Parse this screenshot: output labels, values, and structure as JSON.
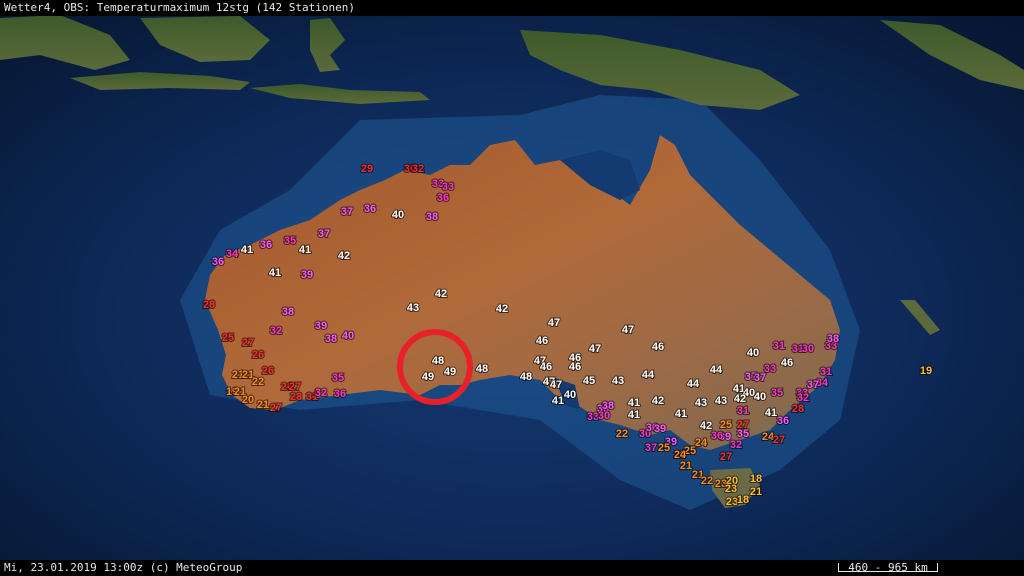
{
  "header": {
    "title": "Wetter4, OBS: Temperaturmaximum 12stg (142 Stationen)"
  },
  "footer": {
    "timestamp": "Mi, 23.01.2019 13:00z (c) MeteoGroup",
    "scale_label": "460 - 965 km"
  },
  "colors": {
    "c30": "#ff2a2a",
    "c35": "#ff33cc",
    "c40": "#ff55ff",
    "c45": "#ffffff",
    "c25": "#ff8a1a",
    "c20": "#ffbf2a",
    "c_red": "#e00000",
    "highlight": "#e8202a"
  },
  "stations": [
    {
      "v": "29",
      "c": "c30"
    },
    {
      "v": "30",
      "c": "c30"
    },
    {
      "v": "32",
      "c": "c30"
    },
    {
      "v": "33",
      "c": "c35"
    },
    {
      "v": "33",
      "c": "c35"
    },
    {
      "v": "36",
      "c": "c35"
    },
    {
      "v": "37",
      "c": "c40"
    },
    {
      "v": "36",
      "c": "c40"
    },
    {
      "v": "40",
      "c": "c45"
    },
    {
      "v": "38",
      "c": "c40"
    },
    {
      "v": "41",
      "c": "c45"
    },
    {
      "v": "36",
      "c": "c40"
    },
    {
      "v": "35",
      "c": "c35"
    },
    {
      "v": "37",
      "c": "c40"
    },
    {
      "v": "41",
      "c": "c45"
    },
    {
      "v": "42",
      "c": "c45"
    },
    {
      "v": "36",
      "c": "c40"
    },
    {
      "v": "34",
      "c": "c35"
    },
    {
      "v": "41",
      "c": "c45"
    },
    {
      "v": "39",
      "c": "c40"
    },
    {
      "v": "42",
      "c": "c45"
    },
    {
      "v": "43",
      "c": "c45"
    },
    {
      "v": "42",
      "c": "c45"
    },
    {
      "v": "28",
      "c": "c30"
    },
    {
      "v": "38",
      "c": "c40"
    },
    {
      "v": "32",
      "c": "c35"
    },
    {
      "v": "39",
      "c": "c40"
    },
    {
      "v": "38",
      "c": "c40"
    },
    {
      "v": "40",
      "c": "c40"
    },
    {
      "v": "25",
      "c": "c30"
    },
    {
      "v": "27",
      "c": "c30"
    },
    {
      "v": "26",
      "c": "c30"
    },
    {
      "v": "21",
      "c": "c25"
    },
    {
      "v": "21",
      "c": "c25"
    },
    {
      "v": "26",
      "c": "c30"
    },
    {
      "v": "22",
      "c": "c25"
    },
    {
      "v": "19",
      "c": "c25"
    },
    {
      "v": "21",
      "c": "c25"
    },
    {
      "v": "20",
      "c": "c25"
    },
    {
      "v": "21",
      "c": "c25"
    },
    {
      "v": "27",
      "c": "c30"
    },
    {
      "v": "26",
      "c": "c30"
    },
    {
      "v": "27",
      "c": "c30"
    },
    {
      "v": "28",
      "c": "c30"
    },
    {
      "v": "31",
      "c": "c30"
    },
    {
      "v": "32",
      "c": "c35"
    },
    {
      "v": "36",
      "c": "c35"
    },
    {
      "v": "35",
      "c": "c35"
    },
    {
      "v": "47",
      "c": "c45"
    },
    {
      "v": "46",
      "c": "c45"
    },
    {
      "v": "47",
      "c": "c45"
    },
    {
      "v": "47",
      "c": "c45"
    },
    {
      "v": "46",
      "c": "c45"
    },
    {
      "v": "47",
      "c": "c45"
    },
    {
      "v": "46",
      "c": "c45"
    },
    {
      "v": "48",
      "c": "c45"
    },
    {
      "v": "49",
      "c": "c45"
    },
    {
      "v": "49",
      "c": "c45"
    },
    {
      "v": "48",
      "c": "c45"
    },
    {
      "v": "48",
      "c": "c45"
    },
    {
      "v": "47",
      "c": "c45"
    },
    {
      "v": "47",
      "c": "c45"
    },
    {
      "v": "46",
      "c": "c45"
    },
    {
      "v": "45",
      "c": "c45"
    },
    {
      "v": "43",
      "c": "c45"
    },
    {
      "v": "44",
      "c": "c45"
    },
    {
      "v": "44",
      "c": "c45"
    },
    {
      "v": "41",
      "c": "c45"
    },
    {
      "v": "40",
      "c": "c45"
    },
    {
      "v": "38",
      "c": "c40"
    },
    {
      "v": "38",
      "c": "c40"
    },
    {
      "v": "33",
      "c": "c35"
    },
    {
      "v": "30",
      "c": "c35"
    },
    {
      "v": "41",
      "c": "c45"
    },
    {
      "v": "41",
      "c": "c45"
    },
    {
      "v": "42",
      "c": "c45"
    },
    {
      "v": "41",
      "c": "c45"
    },
    {
      "v": "43",
      "c": "c45"
    },
    {
      "v": "43",
      "c": "c45"
    },
    {
      "v": "46",
      "c": "c45"
    },
    {
      "v": "44",
      "c": "c45"
    },
    {
      "v": "40",
      "c": "c45"
    },
    {
      "v": "46",
      "c": "c45"
    },
    {
      "v": "31",
      "c": "c35"
    },
    {
      "v": "31",
      "c": "c35"
    },
    {
      "v": "30",
      "c": "c35"
    },
    {
      "v": "33",
      "c": "c35"
    },
    {
      "v": "37",
      "c": "c40"
    },
    {
      "v": "37",
      "c": "c40"
    },
    {
      "v": "33",
      "c": "c35"
    },
    {
      "v": "41",
      "c": "c45"
    },
    {
      "v": "40",
      "c": "c45"
    },
    {
      "v": "40",
      "c": "c45"
    },
    {
      "v": "42",
      "c": "c45"
    },
    {
      "v": "38",
      "c": "c40"
    },
    {
      "v": "31",
      "c": "c35"
    },
    {
      "v": "34",
      "c": "c35"
    },
    {
      "v": "37",
      "c": "c40"
    },
    {
      "v": "33",
      "c": "c35"
    },
    {
      "v": "35",
      "c": "c35"
    },
    {
      "v": "32",
      "c": "c35"
    },
    {
      "v": "28",
      "c": "c30"
    },
    {
      "v": "31",
      "c": "c35"
    },
    {
      "v": "41",
      "c": "c45"
    },
    {
      "v": "36",
      "c": "c40"
    },
    {
      "v": "27",
      "c": "c30"
    },
    {
      "v": "35",
      "c": "c40"
    },
    {
      "v": "24",
      "c": "c25"
    },
    {
      "v": "27",
      "c": "c30"
    },
    {
      "v": "25",
      "c": "c25"
    },
    {
      "v": "42",
      "c": "c45"
    },
    {
      "v": "39",
      "c": "c40"
    },
    {
      "v": "36",
      "c": "c35"
    },
    {
      "v": "32",
      "c": "c35"
    },
    {
      "v": "24",
      "c": "c25"
    },
    {
      "v": "27",
      "c": "c30"
    },
    {
      "v": "22",
      "c": "c25"
    },
    {
      "v": "30",
      "c": "c35"
    },
    {
      "v": "36",
      "c": "c40"
    },
    {
      "v": "39",
      "c": "c40"
    },
    {
      "v": "39",
      "c": "c40"
    },
    {
      "v": "37",
      "c": "c35"
    },
    {
      "v": "25",
      "c": "c25"
    },
    {
      "v": "20",
      "c": "c25"
    },
    {
      "v": "25",
      "c": "c25"
    },
    {
      "v": "24",
      "c": "c25"
    },
    {
      "v": "21",
      "c": "c25"
    },
    {
      "v": "21",
      "c": "c25"
    },
    {
      "v": "22",
      "c": "c25"
    },
    {
      "v": "23",
      "c": "c25"
    },
    {
      "v": "20",
      "c": "c20"
    },
    {
      "v": "23",
      "c": "c20"
    },
    {
      "v": "18",
      "c": "c20"
    },
    {
      "v": "21",
      "c": "c20"
    },
    {
      "v": "23",
      "c": "c20"
    },
    {
      "v": "18",
      "c": "c20"
    },
    {
      "v": "19",
      "c": "c20"
    },
    {
      "v": "30",
      "c": "c_red"
    }
  ]
}
